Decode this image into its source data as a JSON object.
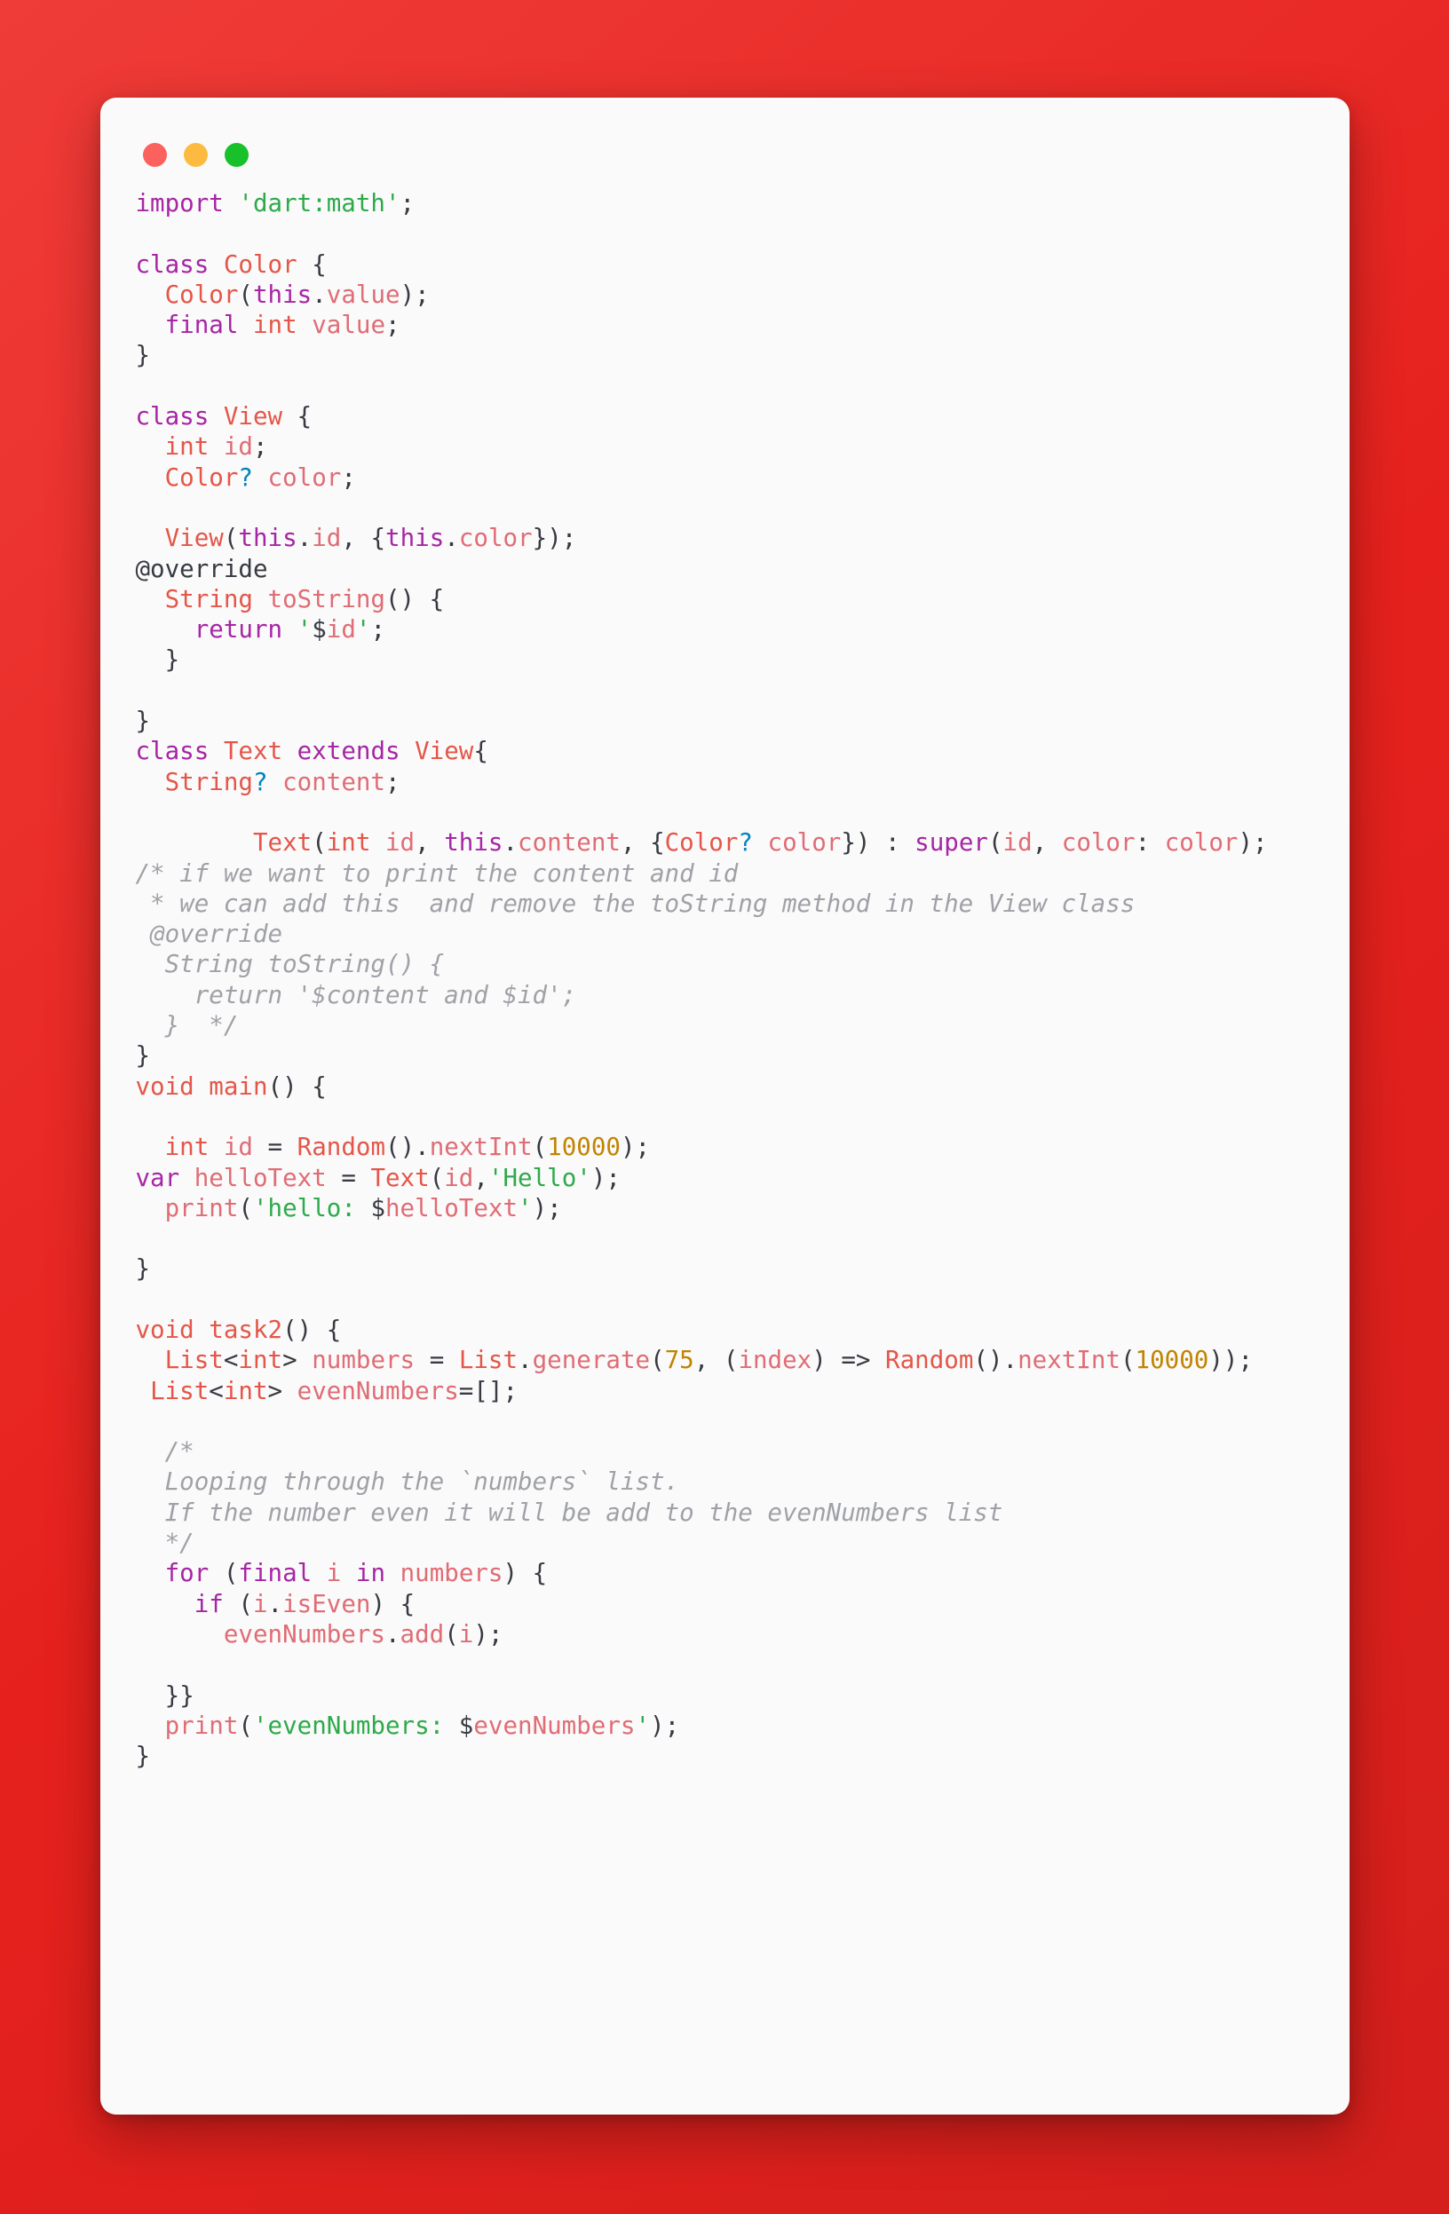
{
  "window": {
    "background_color": "#e6211d",
    "surface_color": "#fafafa",
    "controls": [
      {
        "name": "close",
        "label": "Close",
        "color": "#fc625d"
      },
      {
        "name": "minimize",
        "label": "Minimize",
        "color": "#fcbb40"
      },
      {
        "name": "maximize",
        "label": "Maximize",
        "color": "#18c12a"
      }
    ]
  },
  "syntax_colors": {
    "keyword": "#a626a4",
    "type": "#e45649",
    "property": "#e06c75",
    "string": "#2eaa4a",
    "number": "#c18401",
    "comment": "#a0a1a7",
    "nullable": "#0184bc",
    "punctuation": "#383a42"
  },
  "language": "dart",
  "code": {
    "lines": [
      "import 'dart:math';",
      "",
      "class Color {",
      "  Color(this.value);",
      "  final int value;",
      "}",
      "",
      "class View {",
      "  int id;",
      "  Color? color;",
      "",
      "  View(this.id, {this.color});",
      "@override",
      "  String toString() {",
      "    return '$id';",
      "  }",
      "",
      "}",
      "class Text extends View{",
      "  String? content;",
      "",
      "        Text(int id, this.content, {Color? color}) : super(id, color: color);",
      "/* if we want to print the content and id",
      " * we can add this  and remove the toString method in the View class",
      " @override",
      "  String toString() {",
      "    return '$content and $id';",
      "  }  */",
      "}",
      "void main() {",
      "",
      "  int id = Random().nextInt(10000);",
      "var helloText = Text(id,'Hello');",
      "  print('hello: $helloText');",
      "",
      "}",
      "",
      "void task2() {",
      "  List<int> numbers = List.generate(75, (index) => Random().nextInt(10000));",
      " List<int> evenNumbers=[];",
      "",
      "  /*",
      "  Looping through the `numbers` list.",
      "  If the number even it will be add to the evenNumbers list",
      "  */",
      "  for (final i in numbers) {",
      "    if (i.isEven) {",
      "      evenNumbers.add(i);",
      "",
      "  }}",
      "  print('evenNumbers: $evenNumbers');",
      "}"
    ]
  }
}
